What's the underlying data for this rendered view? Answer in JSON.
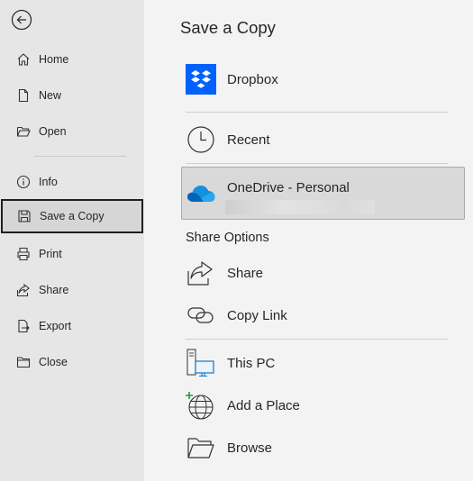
{
  "sidebar": {
    "items": [
      {
        "label": "Home",
        "icon": "home-icon"
      },
      {
        "label": "New",
        "icon": "new-document-icon"
      },
      {
        "label": "Open",
        "icon": "open-folder-icon"
      },
      {
        "label": "Info",
        "icon": "info-icon"
      },
      {
        "label": "Save a Copy",
        "icon": "save-icon"
      },
      {
        "label": "Print",
        "icon": "print-icon"
      },
      {
        "label": "Share",
        "icon": "share-icon"
      },
      {
        "label": "Export",
        "icon": "export-icon"
      },
      {
        "label": "Close",
        "icon": "close-folder-icon"
      }
    ],
    "selected": "Save a Copy"
  },
  "main": {
    "title": "Save a Copy",
    "locations": [
      {
        "label": "Dropbox",
        "icon": "dropbox-icon"
      },
      {
        "label": "Recent",
        "icon": "clock-icon"
      },
      {
        "label": "OneDrive - Personal",
        "icon": "onedrive-cloud-icon"
      }
    ],
    "share_options": {
      "heading": "Share Options",
      "items": [
        {
          "label": "Share",
          "icon": "share-arrow-icon"
        },
        {
          "label": "Copy Link",
          "icon": "link-icon"
        }
      ]
    },
    "other_locations": [
      {
        "label": "This PC",
        "icon": "computer-icon"
      },
      {
        "label": "Add a Place",
        "icon": "globe-add-icon"
      },
      {
        "label": "Browse",
        "icon": "folder-browse-icon"
      }
    ]
  },
  "colors": {
    "sidebar_bg": "#e6e6e6",
    "main_bg": "#f3f3f3",
    "selected_location_bg": "#d9d9d9",
    "dropbox_blue": "#0061fe",
    "onedrive_blue": "#0f78d4"
  }
}
